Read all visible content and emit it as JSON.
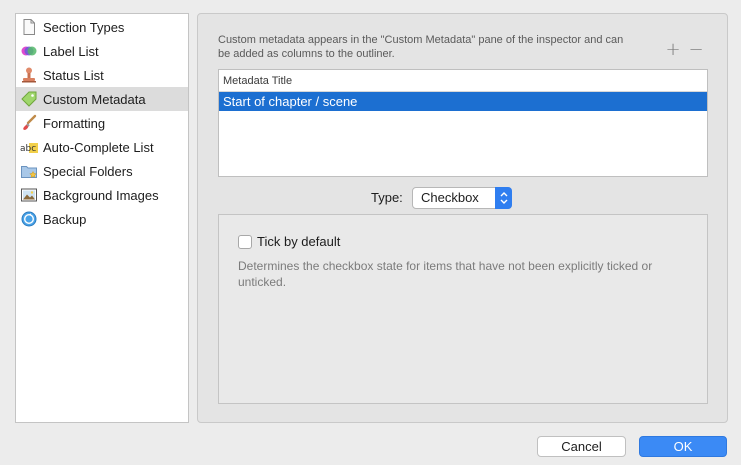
{
  "sidebar": {
    "items": [
      {
        "label": "Section Types",
        "icon": "document-icon"
      },
      {
        "label": "Label List",
        "icon": "color-circles-icon"
      },
      {
        "label": "Status List",
        "icon": "stamp-icon"
      },
      {
        "label": "Custom Metadata",
        "icon": "tag-icon",
        "selected": true
      },
      {
        "label": "Formatting",
        "icon": "paintbrush-icon"
      },
      {
        "label": "Auto-Complete List",
        "icon": "abc-icon"
      },
      {
        "label": "Special Folders",
        "icon": "folder-star-icon"
      },
      {
        "label": "Background Images",
        "icon": "image-icon"
      },
      {
        "label": "Backup",
        "icon": "backup-icon"
      }
    ]
  },
  "panel": {
    "description": "Custom metadata appears in the \"Custom Metadata\" pane of the inspector and can be added as columns to the outliner.",
    "plus": "+",
    "minus": "−",
    "table": {
      "header": "Metadata Title",
      "rows": [
        "Start of chapter / scene"
      ]
    },
    "type_label": "Type:",
    "type_value": "Checkbox",
    "checkbox": {
      "label": "Tick by default",
      "checked": false,
      "help": "Determines the checkbox state for items that have not been explicitly ticked or unticked."
    }
  },
  "buttons": {
    "cancel": "Cancel",
    "ok": "OK"
  },
  "colors": {
    "selection": "#1c6fd1",
    "accent": "#3b8af5"
  }
}
